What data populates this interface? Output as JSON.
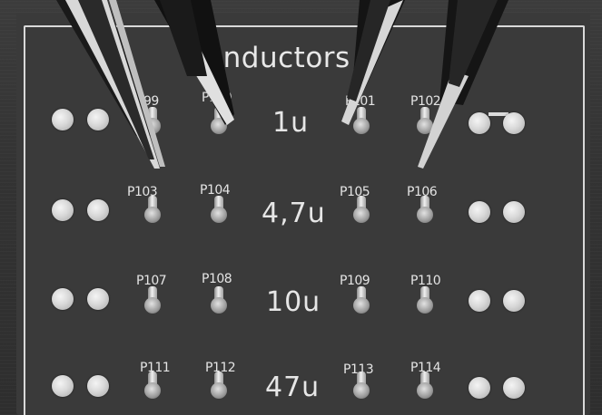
{
  "board": {
    "title": "Inductors",
    "values": [
      "1u",
      "4,7u",
      "10u",
      "47u"
    ]
  },
  "labels": [
    "P99",
    "P100",
    "P101",
    "P102",
    "P103",
    "P104",
    "P105",
    "P106",
    "P107",
    "P108",
    "P109",
    "P110",
    "P111",
    "P112",
    "P113",
    "P114"
  ]
}
